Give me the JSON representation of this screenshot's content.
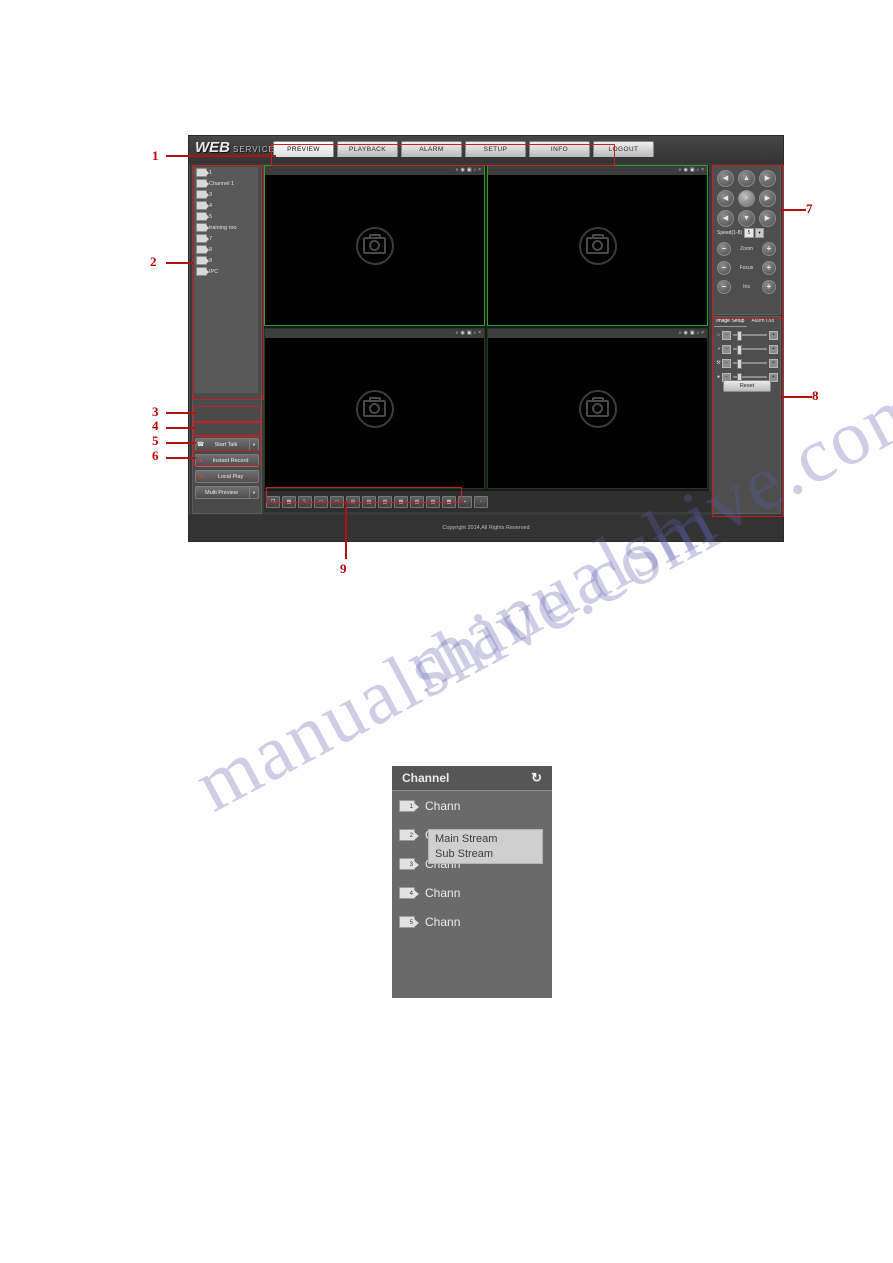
{
  "watermark": {
    "line1": "manualshive.com",
    "line2": ""
  },
  "app": {
    "logo": {
      "name": "WEB",
      "service": "SERVICE"
    },
    "tabs": [
      {
        "label": "PREVIEW",
        "active": true
      },
      {
        "label": "PLAYBACK",
        "active": false
      },
      {
        "label": "ALARM",
        "active": false
      },
      {
        "label": "SETUP",
        "active": false
      },
      {
        "label": "INFO",
        "active": false
      },
      {
        "label": "LOGOUT",
        "active": false
      }
    ],
    "footer": "Copyright 2014,All Rights Reserved"
  },
  "sidebar": {
    "channels": [
      {
        "label": "1"
      },
      {
        "label": "Channel 1"
      },
      {
        "label": "3"
      },
      {
        "label": "4"
      },
      {
        "label": "5"
      },
      {
        "label": "training roo"
      },
      {
        "label": "7"
      },
      {
        "label": "8"
      },
      {
        "label": "9"
      },
      {
        "label": "IPC"
      }
    ],
    "buttons": [
      {
        "icon": "phone-icon",
        "glyph": "☎",
        "label": "Start Talk",
        "dropdown": true
      },
      {
        "icon": "record-icon",
        "glyph": "▲",
        "label": "Instant Record",
        "dropdown": false
      },
      {
        "icon": "playback-icon",
        "glyph": "▤",
        "label": "Local Play",
        "dropdown": false
      },
      {
        "icon": "grid-icon",
        "glyph": "",
        "label": "Multi Preview",
        "dropdown": true
      }
    ]
  },
  "video": {
    "pane_icons": [
      {
        "name": "digital-zoom-icon",
        "glyph": "⌕"
      },
      {
        "name": "local-record-icon",
        "glyph": "◉"
      },
      {
        "name": "snapshot-icon",
        "glyph": "▣"
      },
      {
        "name": "audio-icon",
        "glyph": "♪"
      },
      {
        "name": "close-icon",
        "glyph": "×"
      }
    ],
    "panes": [
      {
        "name": "video-pane-1",
        "selected": true
      },
      {
        "name": "video-pane-2",
        "selected": true
      },
      {
        "name": "video-pane-3",
        "selected": false
      },
      {
        "name": "video-pane-4",
        "selected": false
      }
    ],
    "toolbar": [
      {
        "name": "toolbar-fullscreen",
        "glyph": "❐"
      },
      {
        "name": "toolbar-image-adjust",
        "glyph": "▦"
      },
      {
        "name": "toolbar-aspect-ratio",
        "glyph": "⤡"
      },
      {
        "name": "toolbar-split-1",
        "glyph": "▭"
      },
      {
        "name": "toolbar-split-1b",
        "glyph": "□"
      },
      {
        "name": "toolbar-split-4",
        "glyph": "⊞"
      },
      {
        "name": "toolbar-split-6",
        "glyph": "▤"
      },
      {
        "name": "toolbar-split-8",
        "glyph": "▥"
      },
      {
        "name": "toolbar-split-9",
        "glyph": "▦"
      },
      {
        "name": "toolbar-split-13",
        "glyph": "▧"
      },
      {
        "name": "toolbar-split-16",
        "glyph": "▨"
      },
      {
        "name": "toolbar-split-20",
        "glyph": "▩"
      },
      {
        "name": "toolbar-split-25",
        "glyph": "▪"
      },
      {
        "name": "toolbar-split-36",
        "glyph": "▫"
      }
    ]
  },
  "ptz": {
    "directions": [
      {
        "name": "ptz-up-left",
        "glyph": "◀"
      },
      {
        "name": "ptz-up",
        "glyph": "▲"
      },
      {
        "name": "ptz-up-right",
        "glyph": "▶"
      },
      {
        "name": "ptz-left",
        "glyph": "◀"
      },
      {
        "name": "ptz-zoom-area",
        "glyph": "⌕"
      },
      {
        "name": "ptz-right",
        "glyph": "▶"
      },
      {
        "name": "ptz-down-left",
        "glyph": "◀"
      },
      {
        "name": "ptz-down",
        "glyph": "▼"
      },
      {
        "name": "ptz-down-right",
        "glyph": "▶"
      }
    ],
    "speed_label": "Speed(1-8)",
    "speed_value": "5",
    "rows": [
      {
        "label": "Zoom",
        "minus": "−",
        "plus": "+"
      },
      {
        "label": "Focus",
        "minus": "−",
        "plus": "+"
      },
      {
        "label": "Iris",
        "minus": "−",
        "plus": "+"
      }
    ]
  },
  "image_setup": {
    "tabs": [
      {
        "label": "Image Setup",
        "active": true
      },
      {
        "label": "Alarm Out",
        "active": false
      }
    ],
    "sliders": [
      {
        "name": "brightness-slider",
        "glyph": "☼"
      },
      {
        "name": "contrast-slider",
        "glyph": "◑"
      },
      {
        "name": "hue-slider",
        "glyph": "⚒"
      },
      {
        "name": "saturation-slider",
        "glyph": "●"
      }
    ],
    "reset_label": "Reset"
  },
  "callouts": [
    {
      "num": "1"
    },
    {
      "num": "2"
    },
    {
      "num": "3"
    },
    {
      "num": "4"
    },
    {
      "num": "5"
    },
    {
      "num": "6"
    },
    {
      "num": "7"
    },
    {
      "num": "8"
    },
    {
      "num": "9"
    }
  ],
  "channel_popup": {
    "title": "Channel",
    "refresh_icon": "↻",
    "rows": [
      {
        "num": "1",
        "label": "Chann"
      },
      {
        "num": "2",
        "label": "Chann"
      },
      {
        "num": "3",
        "label": "Chann"
      },
      {
        "num": "4",
        "label": "Chann"
      },
      {
        "num": "5",
        "label": "Chann"
      }
    ],
    "stream_menu": [
      {
        "label": "Main Stream"
      },
      {
        "label": "Sub Stream"
      }
    ]
  }
}
